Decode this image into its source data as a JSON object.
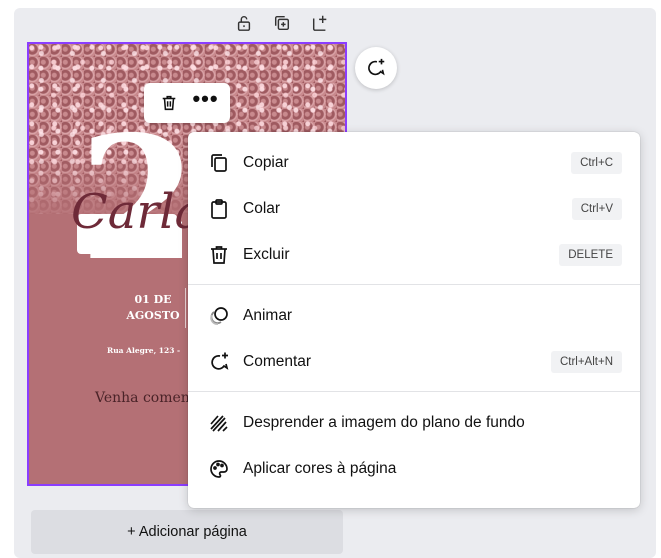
{
  "canvas": {
    "design": {
      "big_number": "20",
      "script_name": "Carla",
      "date_line1": "01 DE",
      "date_line2": "AGOSTO",
      "address": "Rua Alegre, 123 -",
      "invite_text": "Venha comen"
    },
    "add_page_label": "+ Adicionar página"
  },
  "page_tools": {
    "icons": [
      "lock-icon",
      "duplicate-page-icon",
      "add-page-icon"
    ]
  },
  "element_toolbar": {
    "more_label": "•••"
  },
  "context_menu": {
    "items": [
      {
        "icon": "copy-icon",
        "label": "Copiar",
        "shortcut": "Ctrl+C"
      },
      {
        "icon": "paste-icon",
        "label": "Colar",
        "shortcut": "Ctrl+V"
      },
      {
        "icon": "trash-icon",
        "label": "Excluir",
        "shortcut": "DELETE"
      },
      {
        "icon": "animate-icon",
        "label": "Animar",
        "shortcut": ""
      },
      {
        "icon": "comment-add-icon",
        "label": "Comentar",
        "shortcut": "Ctrl+Alt+N"
      },
      {
        "icon": "detach-background-icon",
        "label": "Desprender a imagem do plano de fundo",
        "shortcut": ""
      },
      {
        "icon": "palette-icon",
        "label": "Aplicar cores à página",
        "shortcut": ""
      }
    ]
  },
  "colors": {
    "selection_accent": "#8b3dff",
    "design_background": "#b47075",
    "workspace": "#ebecf0"
  }
}
